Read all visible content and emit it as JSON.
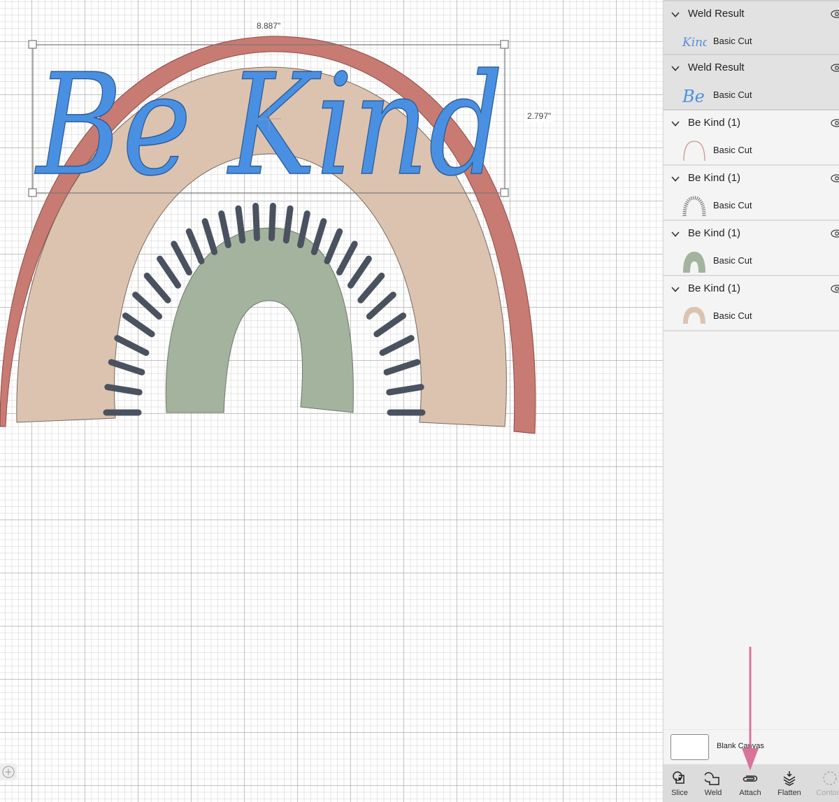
{
  "canvas": {
    "selection": {
      "width_label": "8.887\"",
      "height_label": "2.797\""
    },
    "design_text": "Be Kind",
    "colors": {
      "text_blue": "#4a90e2",
      "outer_arc": "#c87b72",
      "middle_arc": "#dcc3b0",
      "rays": "#4a5260",
      "inner_arc": "#a3b39e"
    },
    "zoom_icon": "zoom-in-icon"
  },
  "layers_panel": {
    "groups": [
      {
        "title": "Weld Result",
        "selected": true,
        "thumbnail": "kind-text-thumbnail",
        "layer_label": "Basic Cut"
      },
      {
        "title": "Weld Result",
        "selected": true,
        "thumbnail": "be-text-thumbnail",
        "layer_label": "Basic Cut"
      },
      {
        "title": "Be Kind (1)",
        "selected": false,
        "thumbnail": "outer-arc-thumbnail",
        "layer_label": "Basic Cut"
      },
      {
        "title": "Be Kind (1)",
        "selected": false,
        "thumbnail": "rays-thumbnail",
        "layer_label": "Basic Cut"
      },
      {
        "title": "Be Kind (1)",
        "selected": false,
        "thumbnail": "green-arc-thumbnail",
        "layer_label": "Basic Cut"
      },
      {
        "title": "Be Kind (1)",
        "selected": false,
        "thumbnail": "tan-arc-thumbnail",
        "layer_label": "Basic Cut"
      }
    ],
    "blank_canvas_label": "Blank Canvas"
  },
  "toolbar": {
    "tools": [
      {
        "label": "Slice",
        "icon": "slice-icon",
        "enabled": true
      },
      {
        "label": "Weld",
        "icon": "weld-icon",
        "enabled": true
      },
      {
        "label": "Attach",
        "icon": "attach-icon",
        "enabled": true
      },
      {
        "label": "Flatten",
        "icon": "flatten-icon",
        "enabled": true
      },
      {
        "label": "Contour",
        "icon": "contour-icon",
        "enabled": false
      }
    ]
  },
  "annotation": {
    "arrow_color": "#d9739b",
    "points_to": "Attach"
  }
}
